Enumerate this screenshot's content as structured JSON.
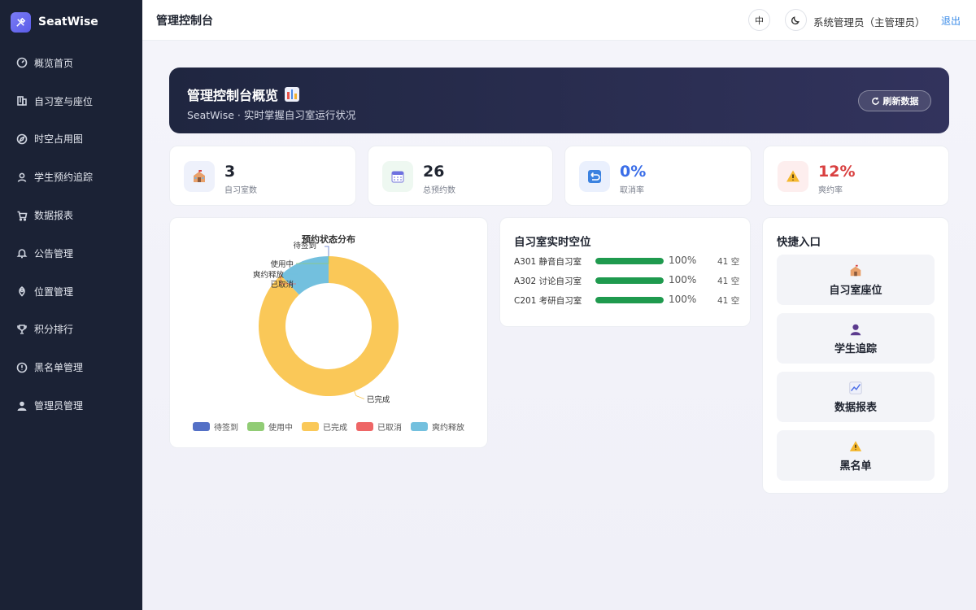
{
  "app": {
    "name": "SeatWise"
  },
  "sidebar": {
    "items": [
      {
        "label": "概览首页",
        "icon": "dashboard-icon"
      },
      {
        "label": "自习室与座位",
        "icon": "building-icon"
      },
      {
        "label": "时空占用图",
        "icon": "compass-icon"
      },
      {
        "label": "学生预约追踪",
        "icon": "user-icon"
      },
      {
        "label": "数据报表",
        "icon": "cart-chart-icon"
      },
      {
        "label": "公告管理",
        "icon": "bell-icon"
      },
      {
        "label": "位置管理",
        "icon": "location-icon"
      },
      {
        "label": "积分排行",
        "icon": "trophy-icon"
      },
      {
        "label": "黑名单管理",
        "icon": "alert-circle-icon"
      },
      {
        "label": "管理员管理",
        "icon": "admin-user-icon"
      }
    ]
  },
  "header": {
    "title": "管理控制台",
    "lang": "中",
    "user": "系统管理员（主管理员）",
    "logout": "退出"
  },
  "banner": {
    "title": "管理控制台概览",
    "subtitle": "SeatWise · 实时掌握自习室运行状况",
    "refresh": "刷新数据"
  },
  "stats": [
    {
      "value": "3",
      "label": "自习室数",
      "icon": "school-icon",
      "color": "#1f2430",
      "bg": "#eef1fb"
    },
    {
      "value": "26",
      "label": "总预约数",
      "icon": "calendar-icon",
      "color": "#1f2430",
      "bg": "#eef8f1"
    },
    {
      "value": "0%",
      "label": "取消率",
      "icon": "return-arrow-icon",
      "color": "#3b6ee8",
      "bg": "#eaf0fd"
    },
    {
      "value": "12%",
      "label": "爽约率",
      "icon": "warning-icon",
      "color": "#d94040",
      "bg": "#fdeeee"
    }
  ],
  "chart_data": {
    "type": "pie",
    "title": "预约状态分布",
    "categories": [
      "待签到",
      "使用中",
      "已完成",
      "已取消",
      "爽约释放"
    ],
    "values": [
      0,
      0,
      88,
      0,
      12
    ],
    "colors": [
      "#5470c6",
      "#91cc75",
      "#fac858",
      "#ee6666",
      "#73c0de"
    ],
    "donut": true,
    "legend": "bottom"
  },
  "rooms": {
    "title": "自习室实时空位",
    "items": [
      {
        "name": "A301 静音自习室",
        "pct": "100%",
        "fill": 1.0,
        "free": "41 空"
      },
      {
        "name": "A302 讨论自习室",
        "pct": "100%",
        "fill": 1.0,
        "free": "41 空"
      },
      {
        "name": "C201 考研自习室",
        "pct": "100%",
        "fill": 1.0,
        "free": "41 空"
      }
    ]
  },
  "quick": {
    "title": "快捷入口",
    "items": [
      {
        "label": "自习室座位",
        "icon": "school-icon"
      },
      {
        "label": "学生追踪",
        "icon": "student-icon"
      },
      {
        "label": "数据报表",
        "icon": "chart-up-icon"
      },
      {
        "label": "黑名单",
        "icon": "warning-icon"
      }
    ]
  }
}
